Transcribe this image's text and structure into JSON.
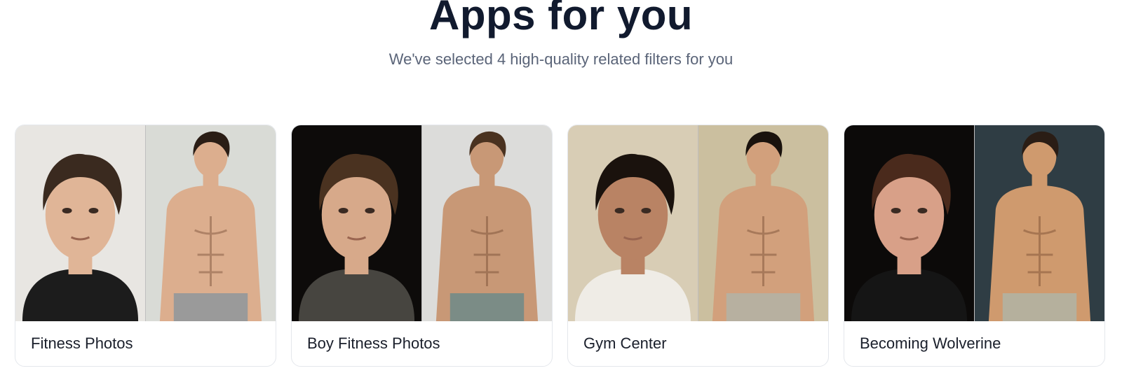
{
  "header": {
    "title": "Apps for you",
    "subtitle": "We've selected 4 high-quality related filters for you"
  },
  "cards": [
    {
      "label": "Fitness Photos",
      "left": {
        "icon": "portrait-photo",
        "bg": "#e8e6e2",
        "skin": "#e0b597",
        "hair": "#3a2a1f",
        "outfit": "#1c1c1c"
      },
      "right": {
        "icon": "shirtless-photo",
        "bg": "#d9dbd6",
        "skin": "#dcae8e",
        "hair": "#2a1d15",
        "pants": "#9a9a9a"
      }
    },
    {
      "label": "Boy Fitness Photos",
      "left": {
        "icon": "portrait-photo",
        "bg": "#0d0b0a",
        "skin": "#d7a98a",
        "hair": "#4a3220",
        "outfit": "#474540"
      },
      "right": {
        "icon": "shirtless-photo",
        "bg": "#dcdcda",
        "skin": "#c89876",
        "hair": "#4a3220",
        "pants": "#7b8c86"
      }
    },
    {
      "label": "Gym Center",
      "left": {
        "icon": "portrait-photo",
        "bg": "#d8cdb5",
        "skin": "#b98364",
        "hair": "#1a120d",
        "outfit": "#efece6"
      },
      "right": {
        "icon": "shirtless-photo",
        "bg": "#cbbf9f",
        "skin": "#d2a07c",
        "hair": "#1a120d",
        "pants": "#b7b0a0"
      }
    },
    {
      "label": "Becoming Wolverine",
      "left": {
        "icon": "portrait-photo",
        "bg": "#0c0a09",
        "skin": "#d8a088",
        "hair": "#4a2a1c",
        "outfit": "#151515"
      },
      "right": {
        "icon": "shirtless-photo",
        "bg": "#2f3d44",
        "skin": "#cf9a6e",
        "hair": "#2a1d15",
        "pants": "#b5b09d"
      }
    }
  ]
}
